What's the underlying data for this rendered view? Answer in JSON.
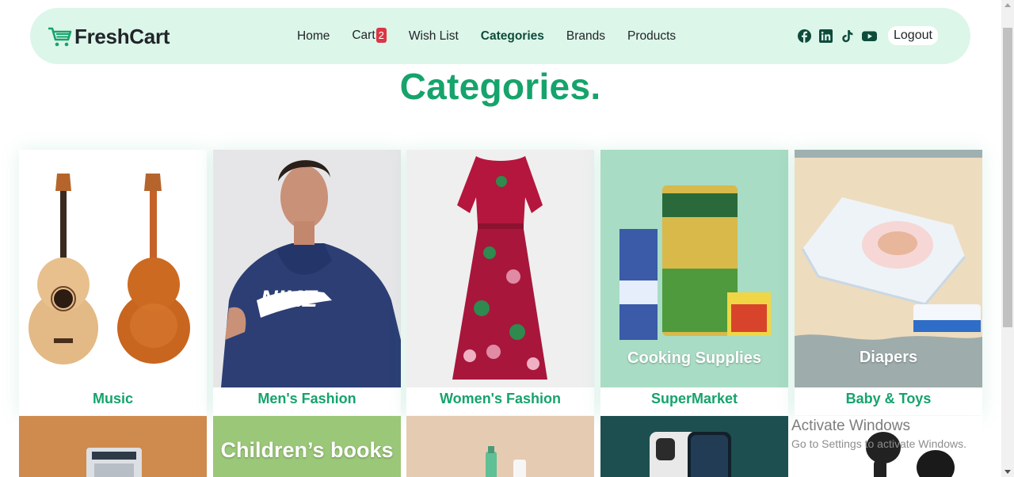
{
  "brand": {
    "name": "FreshCart"
  },
  "nav": {
    "links": [
      {
        "label": "Home"
      },
      {
        "label": "Cart"
      },
      {
        "label": "Wish List"
      },
      {
        "label": "Categories"
      },
      {
        "label": "Brands"
      },
      {
        "label": "Products"
      }
    ],
    "cart_count": "2",
    "logout_label": "Logout",
    "socials": [
      "facebook-icon",
      "linkedin-icon",
      "tiktok-icon",
      "youtube-icon"
    ]
  },
  "page": {
    "title": "Categories."
  },
  "categories": [
    {
      "name": "Music"
    },
    {
      "name": "Men's Fashion"
    },
    {
      "name": "Women's Fashion"
    },
    {
      "name": "SuperMarket",
      "image_text": "Cooking Supplies"
    },
    {
      "name": "Baby & Toys",
      "image_text": "Diapers"
    }
  ],
  "second_row": [
    {
      "image_text": ""
    },
    {
      "image_text": "Children’s books"
    },
    {
      "image_text": ""
    },
    {
      "image_text": ""
    },
    {
      "image_text": ""
    }
  ],
  "watermark": {
    "title": "Activate Windows",
    "subtitle": "Go to Settings to activate Windows."
  },
  "colors": {
    "accent": "#16a36c",
    "nav_bg": "#dcf6e9",
    "badge": "#dc3545"
  }
}
